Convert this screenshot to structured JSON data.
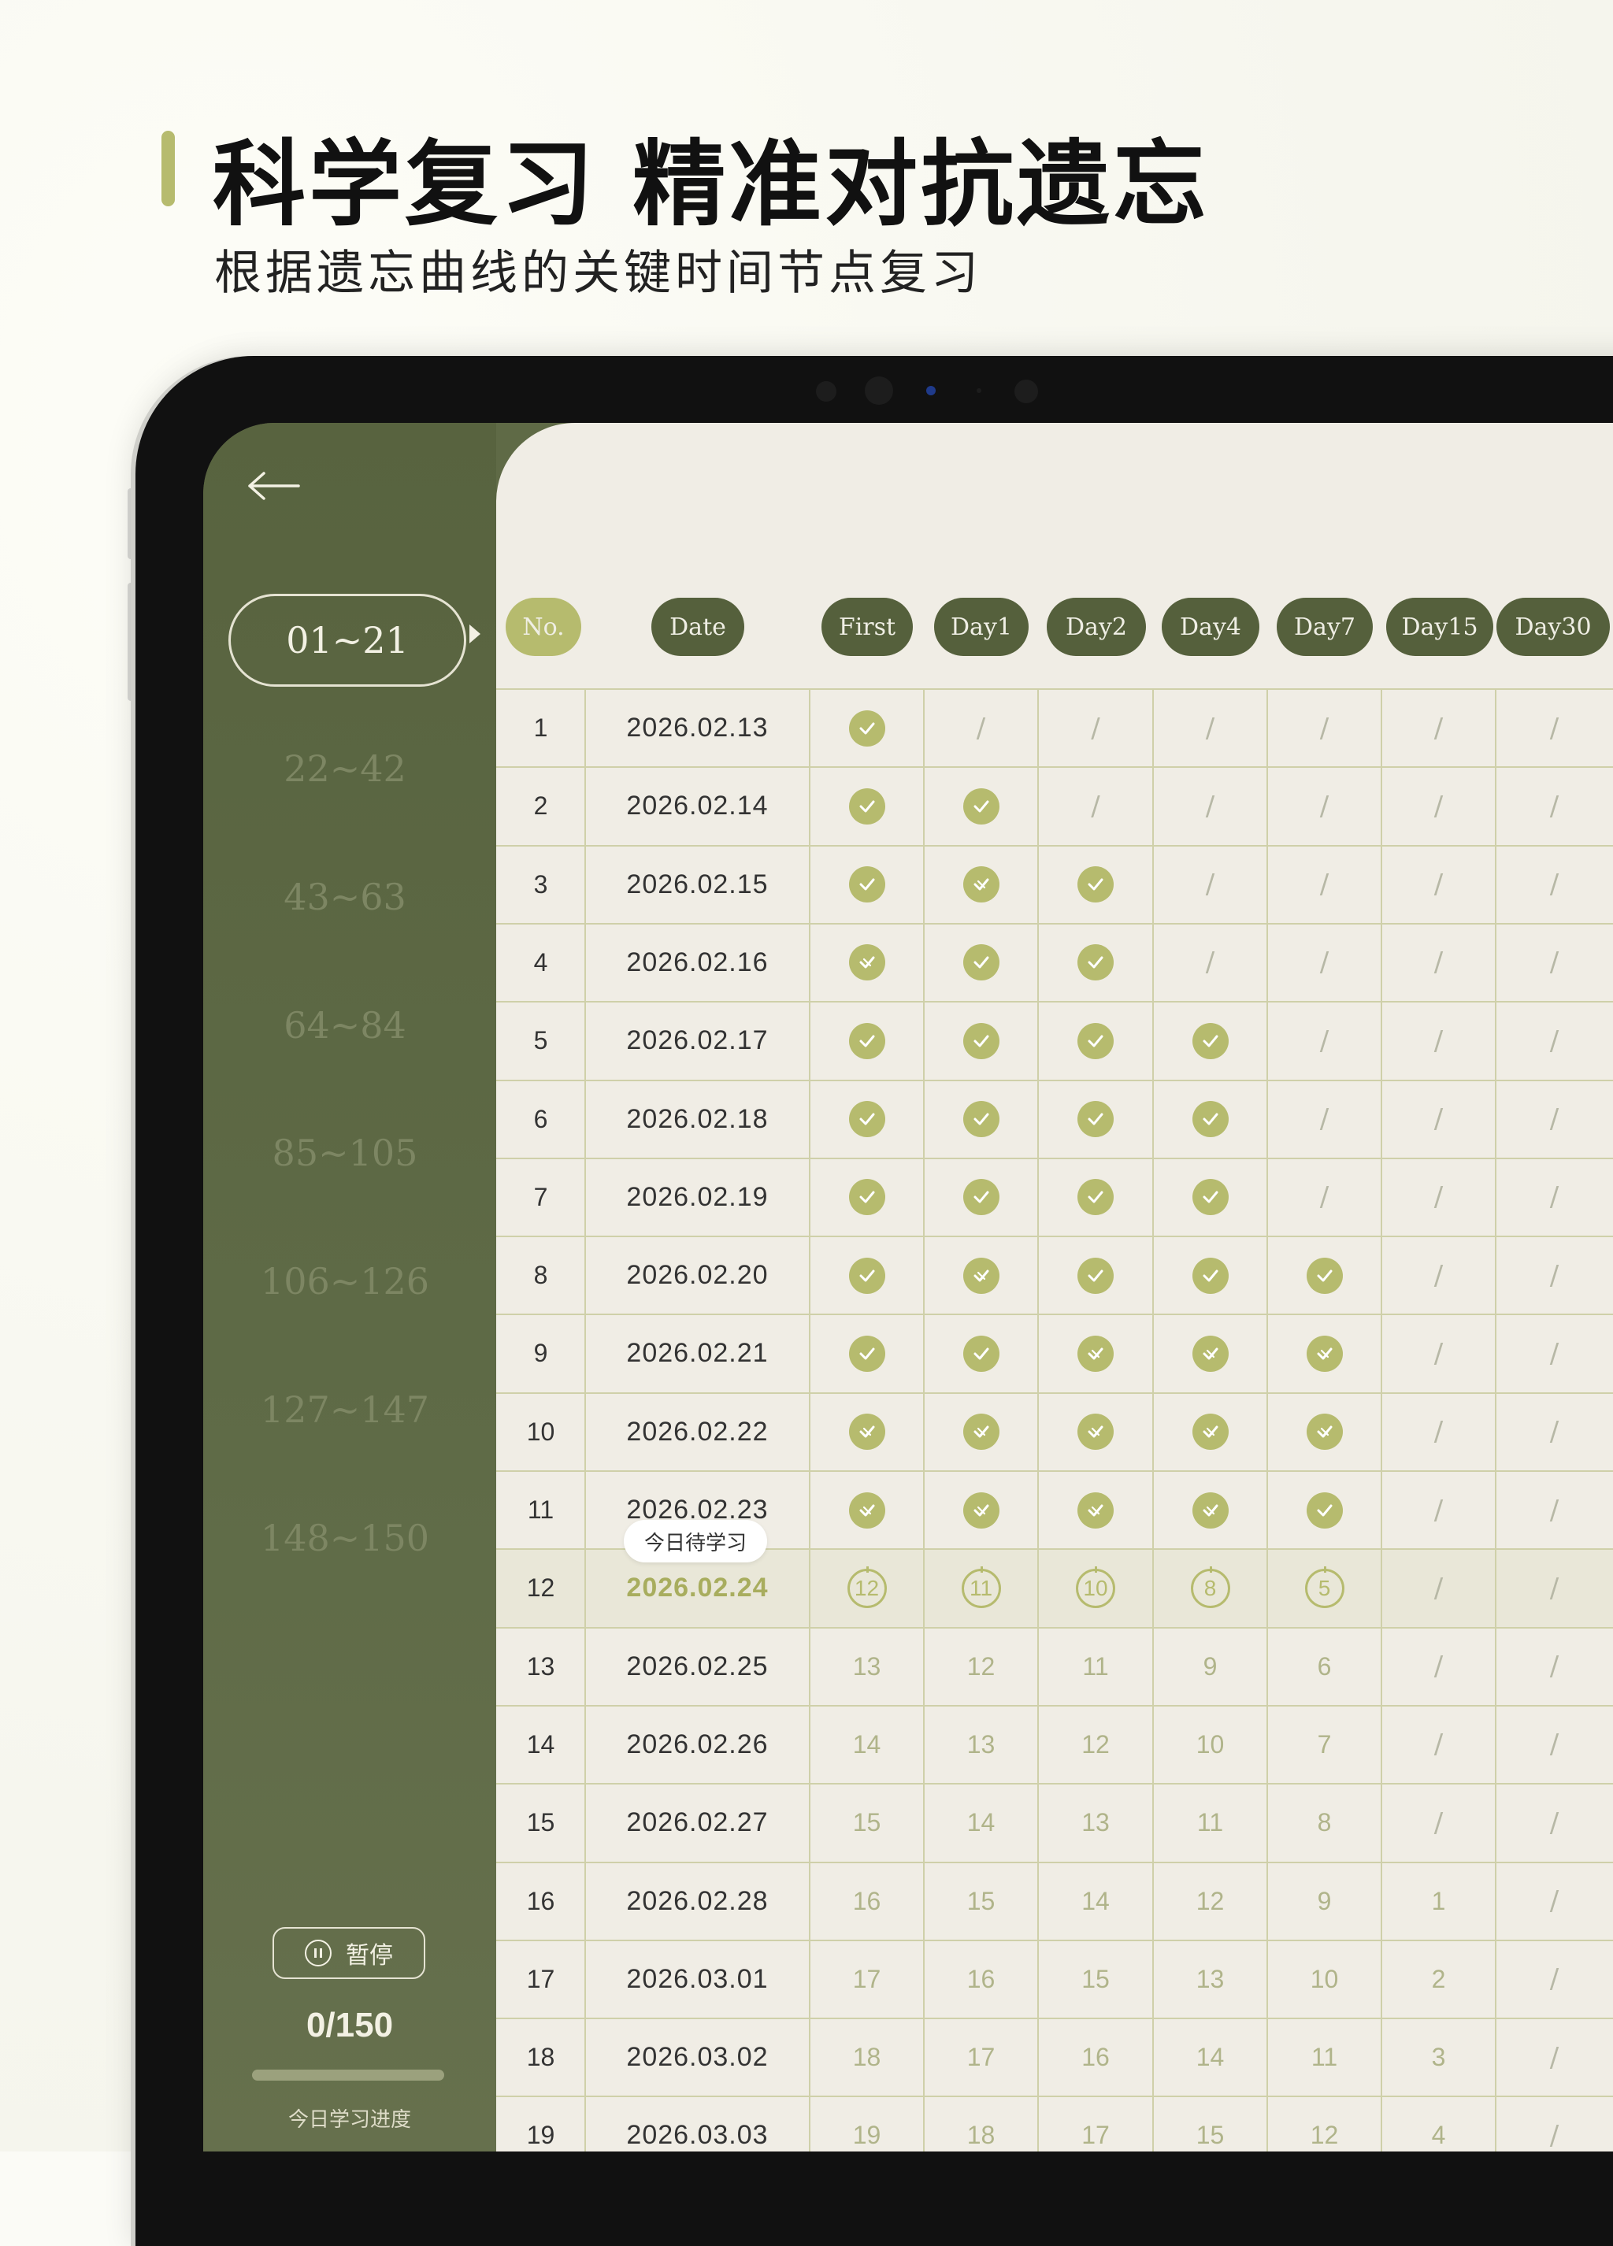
{
  "hero": {
    "title": "科学复习 精准对抗遗忘",
    "subtitle": "根据遗忘曲线的关键时间节点复习"
  },
  "colors": {
    "accent": "#b6bb6e",
    "sidebar": "#5f6a46",
    "panel": "#f0ede5",
    "header_pill": "#55603c"
  },
  "sidebar": {
    "back_icon": "arrow-left-icon",
    "ranges": [
      "01~21",
      "22~42",
      "43~63",
      "64~84",
      "85~105",
      "106~126",
      "127~147",
      "148~150"
    ],
    "active_range": "01~21",
    "pause_label": "暂停",
    "progress_text": "0/150",
    "progress_value": 0,
    "progress_label": "今日学习进度"
  },
  "table": {
    "headers": [
      "No.",
      "Date",
      "First",
      "Day1",
      "Day2",
      "Day4",
      "Day7",
      "Day15",
      "Day30"
    ],
    "today_tip": "今日待学习",
    "rows": [
      {
        "no": "1",
        "date": "2026.02.13",
        "cells": [
          "check",
          "/",
          "/",
          "/",
          "/",
          "/",
          "/"
        ]
      },
      {
        "no": "2",
        "date": "2026.02.14",
        "cells": [
          "check",
          "check",
          "/",
          "/",
          "/",
          "/",
          "/"
        ]
      },
      {
        "no": "3",
        "date": "2026.02.15",
        "cells": [
          "check",
          "check-x",
          "check",
          "/",
          "/",
          "/",
          "/"
        ]
      },
      {
        "no": "4",
        "date": "2026.02.16",
        "cells": [
          "check-x",
          "check",
          "check",
          "/",
          "/",
          "/",
          "/"
        ]
      },
      {
        "no": "5",
        "date": "2026.02.17",
        "cells": [
          "check",
          "check",
          "check",
          "check",
          "/",
          "/",
          "/"
        ]
      },
      {
        "no": "6",
        "date": "2026.02.18",
        "cells": [
          "check",
          "check",
          "check",
          "check",
          "/",
          "/",
          "/"
        ]
      },
      {
        "no": "7",
        "date": "2026.02.19",
        "cells": [
          "check",
          "check",
          "check",
          "check",
          "/",
          "/",
          "/"
        ]
      },
      {
        "no": "8",
        "date": "2026.02.20",
        "cells": [
          "check",
          "check-x",
          "check",
          "check",
          "check",
          "/",
          "/"
        ]
      },
      {
        "no": "9",
        "date": "2026.02.21",
        "cells": [
          "check",
          "check",
          "check-x",
          "check-x",
          "check-x",
          "/",
          "/"
        ]
      },
      {
        "no": "10",
        "date": "2026.02.22",
        "cells": [
          "check-x",
          "check-x",
          "check-x",
          "check-x",
          "check-x",
          "/",
          "/"
        ]
      },
      {
        "no": "11",
        "date": "2026.02.23",
        "cells": [
          "check-x",
          "check-x",
          "check-x",
          "check-x",
          "check",
          "/",
          "/"
        ]
      },
      {
        "no": "12",
        "date": "2026.02.24",
        "today": true,
        "cells": [
          "today:12",
          "today:11",
          "today:10",
          "today:8",
          "today:5",
          "/",
          "/"
        ]
      },
      {
        "no": "13",
        "date": "2026.02.25",
        "cells": [
          "13",
          "12",
          "11",
          "9",
          "6",
          "/",
          "/"
        ]
      },
      {
        "no": "14",
        "date": "2026.02.26",
        "cells": [
          "14",
          "13",
          "12",
          "10",
          "7",
          "/",
          "/"
        ]
      },
      {
        "no": "15",
        "date": "2026.02.27",
        "cells": [
          "15",
          "14",
          "13",
          "11",
          "8",
          "/",
          "/"
        ]
      },
      {
        "no": "16",
        "date": "2026.02.28",
        "cells": [
          "16",
          "15",
          "14",
          "12",
          "9",
          "1",
          "/"
        ]
      },
      {
        "no": "17",
        "date": "2026.03.01",
        "cells": [
          "17",
          "16",
          "15",
          "13",
          "10",
          "2",
          "/"
        ]
      },
      {
        "no": "18",
        "date": "2026.03.02",
        "cells": [
          "18",
          "17",
          "16",
          "14",
          "11",
          "3",
          "/"
        ]
      },
      {
        "no": "19",
        "date": "2026.03.03",
        "cells": [
          "19",
          "18",
          "17",
          "15",
          "12",
          "4",
          "/"
        ]
      }
    ]
  }
}
